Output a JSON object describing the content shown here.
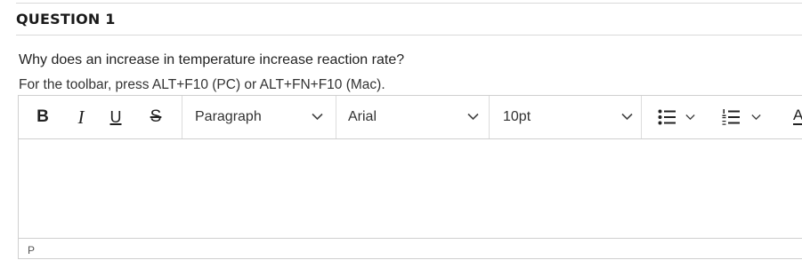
{
  "question": {
    "title": "QUESTION 1",
    "text": "Why does an increase in temperature increase reaction rate?",
    "toolbar_hint": "For the toolbar, press ALT+F10 (PC) or ALT+FN+F10 (Mac)."
  },
  "toolbar": {
    "bold_label": "B",
    "italic_label": "I",
    "underline_label": "U",
    "strikethrough_label": "S",
    "block_format": "Paragraph",
    "font_family": "Arial",
    "font_size": "10pt",
    "bullet_list_icon": "bullet-list-icon",
    "numbered_list_icon": "numbered-list-icon",
    "text_color_label": "A"
  },
  "editor": {
    "content": "",
    "path": "P"
  },
  "colors": {
    "border": "#cfcfcf",
    "text": "#222222",
    "muted": "#555555"
  }
}
